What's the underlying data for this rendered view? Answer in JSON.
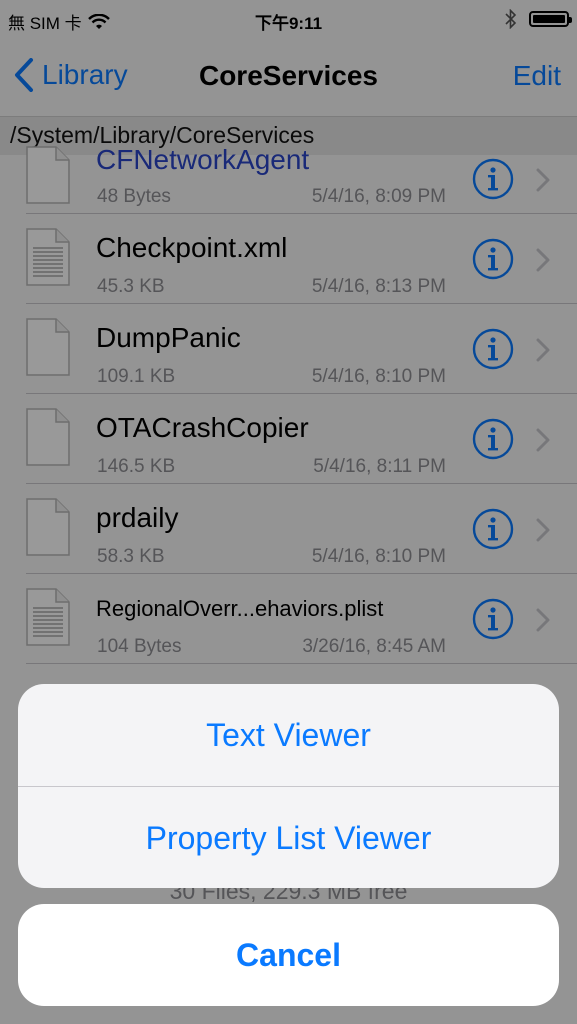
{
  "status_bar": {
    "carrier": "無 SIM 卡",
    "time": "下午9:11"
  },
  "nav": {
    "back_label": "Library",
    "title": "CoreServices",
    "edit_label": "Edit"
  },
  "path": "/System/Library/CoreServices",
  "files": [
    {
      "name": "CFNetworkAgent",
      "size": "48 Bytes",
      "date": "5/4/16, 8:09 PM",
      "icon": "blank-doc-icon"
    },
    {
      "name": "Checkpoint.xml",
      "size": "45.3 KB",
      "date": "5/4/16, 8:13 PM",
      "icon": "text-doc-icon"
    },
    {
      "name": "DumpPanic",
      "size": "109.1 KB",
      "date": "5/4/16, 8:10 PM",
      "icon": "blank-doc-icon"
    },
    {
      "name": "OTACrashCopier",
      "size": "146.5 KB",
      "date": "5/4/16, 8:11 PM",
      "icon": "blank-doc-icon"
    },
    {
      "name": "prdaily",
      "size": "58.3 KB",
      "date": "5/4/16, 8:10 PM",
      "icon": "blank-doc-icon"
    },
    {
      "name": "RegionalOverr...ehaviors.plist",
      "size": "104 Bytes",
      "date": "3/26/16, 8:45 AM",
      "icon": "text-doc-icon"
    }
  ],
  "footer": {
    "count": "30 Files, 229.3 MB free"
  },
  "action_sheet": {
    "options": [
      "Text Viewer",
      "Property List Viewer"
    ],
    "cancel_label": "Cancel"
  },
  "colors": {
    "accent": "#0a7aff",
    "secondary_text": "#8e8e93",
    "overlay": "rgba(0,0,0,0.40)"
  }
}
